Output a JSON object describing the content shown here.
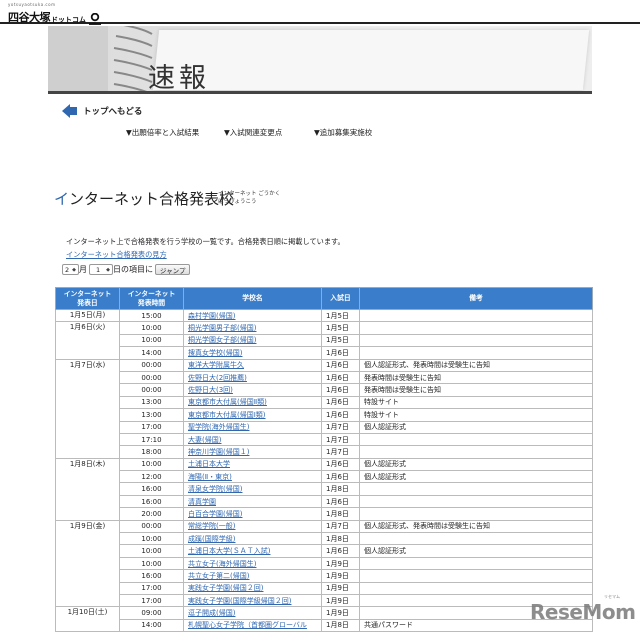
{
  "header": {
    "logo_tiny": "yotsuyaotsuka.com",
    "logo_main": "四谷大塚",
    "logo_sub": "ドットコム"
  },
  "banner": {
    "title": "速報"
  },
  "back": {
    "label": "トップへもどる"
  },
  "nav": [
    {
      "label": "▼出願倍率と入試結果"
    },
    {
      "label": "▼入試関連変更点"
    },
    {
      "label": "▼追加募集実施校"
    }
  ],
  "section": {
    "title_first": "イ",
    "title_rest": "ンターネット合格発表校",
    "ruby_line1": "インターネット ごうかく",
    "ruby_line2": "はっぴょうこう"
  },
  "description": "インターネット上で合格発表を行う学校の一覧です。合格発表日順に掲載しています。",
  "howto_link": "インターネット合格発表の見方",
  "jump": {
    "month_value": "2",
    "month_unit": "月",
    "day_value": "1",
    "day_unit": "日の項目に",
    "button": "ジャンプ"
  },
  "table": {
    "headers": {
      "date": "インターネット\n発表日",
      "time": "インターネット\n発表時間",
      "school": "学校名",
      "exam": "入試日",
      "note": "備考"
    },
    "groups": [
      {
        "date": "1月5日(月)",
        "rows": [
          {
            "time": "15:00",
            "school": "森村学園(帰国)",
            "exam": "1月5日",
            "note": ""
          }
        ]
      },
      {
        "date": "1月6日(火)",
        "rows": [
          {
            "time": "10:00",
            "school": "桐光学園男子部(帰国)",
            "exam": "1月5日",
            "note": ""
          },
          {
            "time": "10:00",
            "school": "桐光学園女子部(帰国)",
            "exam": "1月5日",
            "note": ""
          },
          {
            "time": "14:00",
            "school": "捜真女学校(帰国)",
            "exam": "1月6日",
            "note": ""
          }
        ]
      },
      {
        "date": "1月7日(水)",
        "rows": [
          {
            "time": "00:00",
            "school": "東洋大学附属牛久",
            "exam": "1月6日",
            "note": "個人認証形式、発表時間は受験生に告知"
          },
          {
            "time": "00:00",
            "school": "佐野日大(2回推薦)",
            "exam": "1月6日",
            "note": "発表時間は受験生に告知"
          },
          {
            "time": "00:00",
            "school": "佐野日大(3回)",
            "exam": "1月6日",
            "note": "発表時間は受験生に告知"
          },
          {
            "time": "13:00",
            "school": "東京都市大付属(帰国Ⅱ類)",
            "exam": "1月6日",
            "note": "特設サイト"
          },
          {
            "time": "13:00",
            "school": "東京都市大付属(帰国Ⅰ類)",
            "exam": "1月6日",
            "note": "特設サイト"
          },
          {
            "time": "17:00",
            "school": "聖学院(海外帰国生)",
            "exam": "1月7日",
            "note": "個人認証形式"
          },
          {
            "time": "17:10",
            "school": "大妻(帰国)",
            "exam": "1月7日",
            "note": ""
          },
          {
            "time": "18:00",
            "school": "神奈川学園(帰国１)",
            "exam": "1月7日",
            "note": ""
          }
        ]
      },
      {
        "date": "1月8日(木)",
        "rows": [
          {
            "time": "10:00",
            "school": "土浦日本大学",
            "exam": "1月6日",
            "note": "個人認証形式"
          },
          {
            "time": "12:00",
            "school": "海陽(Ⅱ・東京)",
            "exam": "1月6日",
            "note": "個人認証形式"
          },
          {
            "time": "16:00",
            "school": "清泉女学院(帰国)",
            "exam": "1月8日",
            "note": ""
          },
          {
            "time": "16:00",
            "school": "清真学園",
            "exam": "1月6日",
            "note": ""
          },
          {
            "time": "20:00",
            "school": "白百合学園(帰国)",
            "exam": "1月8日",
            "note": ""
          }
        ]
      },
      {
        "date": "1月9日(金)",
        "rows": [
          {
            "time": "00:00",
            "school": "常総学院(一般)",
            "exam": "1月7日",
            "note": "個人認証形式、発表時間は受験生に告知"
          },
          {
            "time": "10:00",
            "school": "成蹊(国際学級)",
            "exam": "1月8日",
            "note": ""
          },
          {
            "time": "10:00",
            "school": "土浦日本大学(ＳＡＴ入試)",
            "exam": "1月6日",
            "note": "個人認証形式"
          },
          {
            "time": "10:00",
            "school": "共立女子(海外帰国生)",
            "exam": "1月9日",
            "note": ""
          },
          {
            "time": "16:00",
            "school": "共立女子第二(帰国)",
            "exam": "1月9日",
            "note": ""
          },
          {
            "time": "17:00",
            "school": "実践女子学園(帰国２回)",
            "exam": "1月9日",
            "note": ""
          },
          {
            "time": "17:00",
            "school": "実践女子学園(国際学級帰国２回)",
            "exam": "1月9日",
            "note": ""
          }
        ]
      },
      {
        "date": "1月10日(土)",
        "rows": [
          {
            "time": "09:00",
            "school": "逗子開成(帰国)",
            "exam": "1月9日",
            "note": ""
          },
          {
            "time": "14:00",
            "school": "札幌聖心女子学院（首都圏グローバル",
            "exam": "1月8日",
            "note": "共通パスワード"
          }
        ]
      }
    ]
  },
  "watermark": {
    "text": "ReseMom",
    "sub": "リセマム"
  },
  "colors": {
    "accent": "#2f67b0",
    "header_bg": "#3a7ecb"
  }
}
